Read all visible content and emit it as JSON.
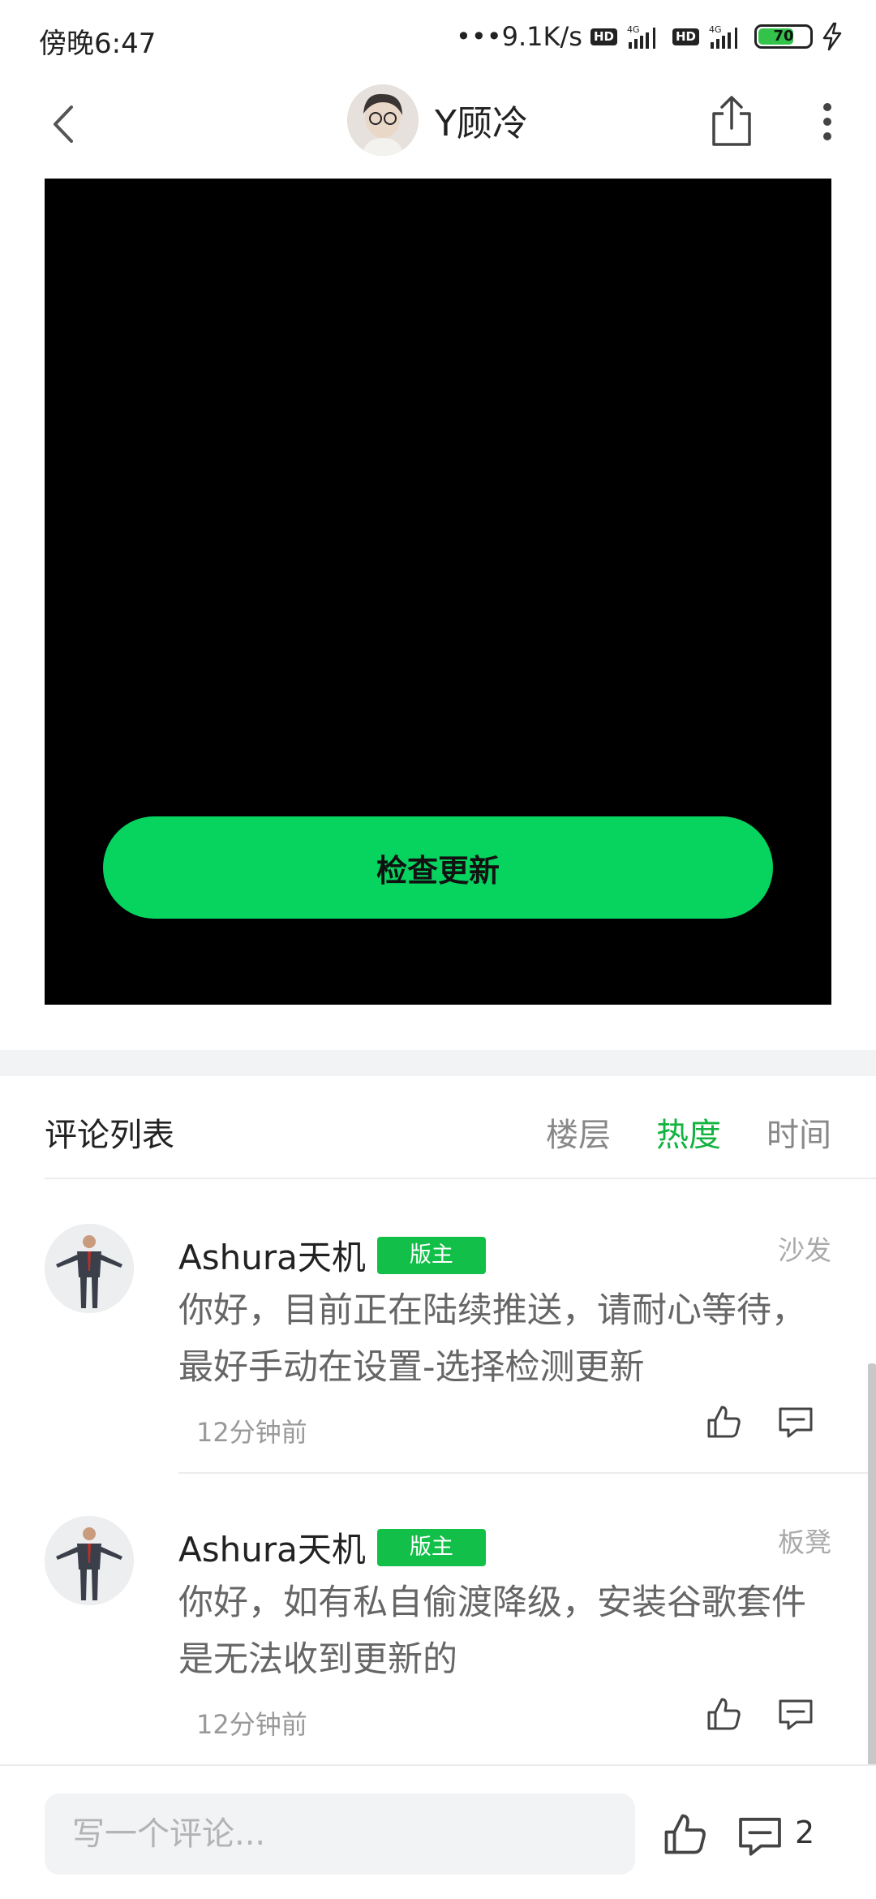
{
  "status": {
    "time": "傍晚6:47",
    "net_speed": "•••9.1K/s",
    "hd1": "HD",
    "hd2": "HD",
    "battery": "70",
    "battery_level": 0.7
  },
  "header": {
    "author_name": "Y顾冷"
  },
  "media": {
    "button_label": "检查更新"
  },
  "comments_header": {
    "title": "评论列表",
    "tabs": [
      {
        "label": "楼层",
        "active": false
      },
      {
        "label": "热度",
        "active": true
      },
      {
        "label": "时间",
        "active": false
      }
    ]
  },
  "comments": [
    {
      "name": "Ashura天机",
      "badge": "版主",
      "floor": "沙发",
      "text": "你好，目前正在陆续推送，请耐心等待，最好手动在设置-选择检测更新",
      "time": "12分钟前"
    },
    {
      "name": "Ashura天机",
      "badge": "版主",
      "floor": "板凳",
      "text": "你好，如有私自偷渡降级，安装谷歌套件是无法收到更新的",
      "time": "12分钟前"
    }
  ],
  "bottom": {
    "input_placeholder": "写一个评论...",
    "reply_count": "2"
  },
  "colors": {
    "accent": "#12b33f",
    "button_green": "#07d35f"
  }
}
